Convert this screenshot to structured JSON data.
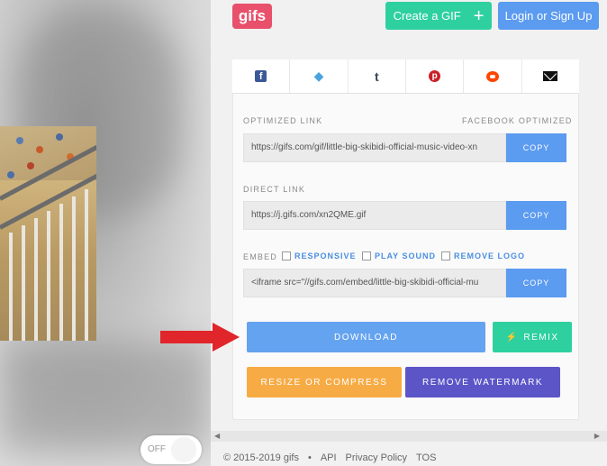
{
  "header": {
    "logo_text": "gifs",
    "create_label": "Create a GIF",
    "create_icon": "+",
    "login_label": "Login or Sign Up"
  },
  "share": {
    "icons": [
      "facebook-icon",
      "twitter-icon",
      "tumblr-icon",
      "pinterest-icon",
      "reddit-icon",
      "email-icon"
    ],
    "facebook_glyph": "f",
    "twitter_glyph": "🐦",
    "tumblr_glyph": "t",
    "pinterest_glyph": "p"
  },
  "optimized": {
    "label": "OPTIMIZED LINK",
    "badge": "FACEBOOK OPTIMIZED",
    "value": "https://gifs.com/gif/little-big-skibidi-official-music-video-xn",
    "copy_label": "COPY"
  },
  "direct": {
    "label": "DIRECT LINK",
    "value": "https://j.gifs.com/xn2QME.gif",
    "copy_label": "COPY"
  },
  "embed": {
    "label": "EMBED",
    "options": [
      "RESPONSIVE",
      "PLAY SOUND",
      "REMOVE LOGO"
    ],
    "value": "<iframe src=\"//gifs.com/embed/little-big-skibidi-official-mu",
    "copy_label": "COPY"
  },
  "actions": {
    "download_label": "DOWNLOAD",
    "remix_label": "REMIX",
    "resize_label": "RESIZE OR COMPRESS",
    "watermark_label": "REMOVE WATERMARK"
  },
  "toggle": {
    "label": "OFF"
  },
  "footer": {
    "copyright": "© 2015-2019 gifs",
    "sep": "•",
    "api": "API",
    "privacy": "Privacy Policy",
    "tos": "TOS"
  },
  "colors": {
    "brand": "#e8506b",
    "green": "#2ed0a0",
    "blue": "#5b9bf0",
    "orange": "#f7ab45",
    "purple": "#5b55c8",
    "arrow": "#e0252b"
  }
}
